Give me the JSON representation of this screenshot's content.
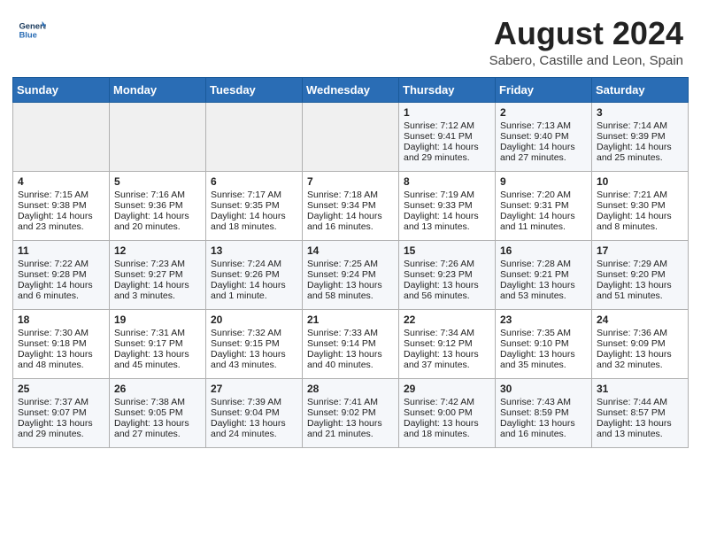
{
  "header": {
    "logo_line1": "General",
    "logo_line2": "Blue",
    "month_year": "August 2024",
    "location": "Sabero, Castille and Leon, Spain"
  },
  "days_of_week": [
    "Sunday",
    "Monday",
    "Tuesday",
    "Wednesday",
    "Thursday",
    "Friday",
    "Saturday"
  ],
  "weeks": [
    [
      {
        "day": "",
        "content": ""
      },
      {
        "day": "",
        "content": ""
      },
      {
        "day": "",
        "content": ""
      },
      {
        "day": "",
        "content": ""
      },
      {
        "day": "1",
        "content": "Sunrise: 7:12 AM\nSunset: 9:41 PM\nDaylight: 14 hours\nand 29 minutes."
      },
      {
        "day": "2",
        "content": "Sunrise: 7:13 AM\nSunset: 9:40 PM\nDaylight: 14 hours\nand 27 minutes."
      },
      {
        "day": "3",
        "content": "Sunrise: 7:14 AM\nSunset: 9:39 PM\nDaylight: 14 hours\nand 25 minutes."
      }
    ],
    [
      {
        "day": "4",
        "content": "Sunrise: 7:15 AM\nSunset: 9:38 PM\nDaylight: 14 hours\nand 23 minutes."
      },
      {
        "day": "5",
        "content": "Sunrise: 7:16 AM\nSunset: 9:36 PM\nDaylight: 14 hours\nand 20 minutes."
      },
      {
        "day": "6",
        "content": "Sunrise: 7:17 AM\nSunset: 9:35 PM\nDaylight: 14 hours\nand 18 minutes."
      },
      {
        "day": "7",
        "content": "Sunrise: 7:18 AM\nSunset: 9:34 PM\nDaylight: 14 hours\nand 16 minutes."
      },
      {
        "day": "8",
        "content": "Sunrise: 7:19 AM\nSunset: 9:33 PM\nDaylight: 14 hours\nand 13 minutes."
      },
      {
        "day": "9",
        "content": "Sunrise: 7:20 AM\nSunset: 9:31 PM\nDaylight: 14 hours\nand 11 minutes."
      },
      {
        "day": "10",
        "content": "Sunrise: 7:21 AM\nSunset: 9:30 PM\nDaylight: 14 hours\nand 8 minutes."
      }
    ],
    [
      {
        "day": "11",
        "content": "Sunrise: 7:22 AM\nSunset: 9:28 PM\nDaylight: 14 hours\nand 6 minutes."
      },
      {
        "day": "12",
        "content": "Sunrise: 7:23 AM\nSunset: 9:27 PM\nDaylight: 14 hours\nand 3 minutes."
      },
      {
        "day": "13",
        "content": "Sunrise: 7:24 AM\nSunset: 9:26 PM\nDaylight: 14 hours\nand 1 minute."
      },
      {
        "day": "14",
        "content": "Sunrise: 7:25 AM\nSunset: 9:24 PM\nDaylight: 13 hours\nand 58 minutes."
      },
      {
        "day": "15",
        "content": "Sunrise: 7:26 AM\nSunset: 9:23 PM\nDaylight: 13 hours\nand 56 minutes."
      },
      {
        "day": "16",
        "content": "Sunrise: 7:28 AM\nSunset: 9:21 PM\nDaylight: 13 hours\nand 53 minutes."
      },
      {
        "day": "17",
        "content": "Sunrise: 7:29 AM\nSunset: 9:20 PM\nDaylight: 13 hours\nand 51 minutes."
      }
    ],
    [
      {
        "day": "18",
        "content": "Sunrise: 7:30 AM\nSunset: 9:18 PM\nDaylight: 13 hours\nand 48 minutes."
      },
      {
        "day": "19",
        "content": "Sunrise: 7:31 AM\nSunset: 9:17 PM\nDaylight: 13 hours\nand 45 minutes."
      },
      {
        "day": "20",
        "content": "Sunrise: 7:32 AM\nSunset: 9:15 PM\nDaylight: 13 hours\nand 43 minutes."
      },
      {
        "day": "21",
        "content": "Sunrise: 7:33 AM\nSunset: 9:14 PM\nDaylight: 13 hours\nand 40 minutes."
      },
      {
        "day": "22",
        "content": "Sunrise: 7:34 AM\nSunset: 9:12 PM\nDaylight: 13 hours\nand 37 minutes."
      },
      {
        "day": "23",
        "content": "Sunrise: 7:35 AM\nSunset: 9:10 PM\nDaylight: 13 hours\nand 35 minutes."
      },
      {
        "day": "24",
        "content": "Sunrise: 7:36 AM\nSunset: 9:09 PM\nDaylight: 13 hours\nand 32 minutes."
      }
    ],
    [
      {
        "day": "25",
        "content": "Sunrise: 7:37 AM\nSunset: 9:07 PM\nDaylight: 13 hours\nand 29 minutes."
      },
      {
        "day": "26",
        "content": "Sunrise: 7:38 AM\nSunset: 9:05 PM\nDaylight: 13 hours\nand 27 minutes."
      },
      {
        "day": "27",
        "content": "Sunrise: 7:39 AM\nSunset: 9:04 PM\nDaylight: 13 hours\nand 24 minutes."
      },
      {
        "day": "28",
        "content": "Sunrise: 7:41 AM\nSunset: 9:02 PM\nDaylight: 13 hours\nand 21 minutes."
      },
      {
        "day": "29",
        "content": "Sunrise: 7:42 AM\nSunset: 9:00 PM\nDaylight: 13 hours\nand 18 minutes."
      },
      {
        "day": "30",
        "content": "Sunrise: 7:43 AM\nSunset: 8:59 PM\nDaylight: 13 hours\nand 16 minutes."
      },
      {
        "day": "31",
        "content": "Sunrise: 7:44 AM\nSunset: 8:57 PM\nDaylight: 13 hours\nand 13 minutes."
      }
    ]
  ]
}
